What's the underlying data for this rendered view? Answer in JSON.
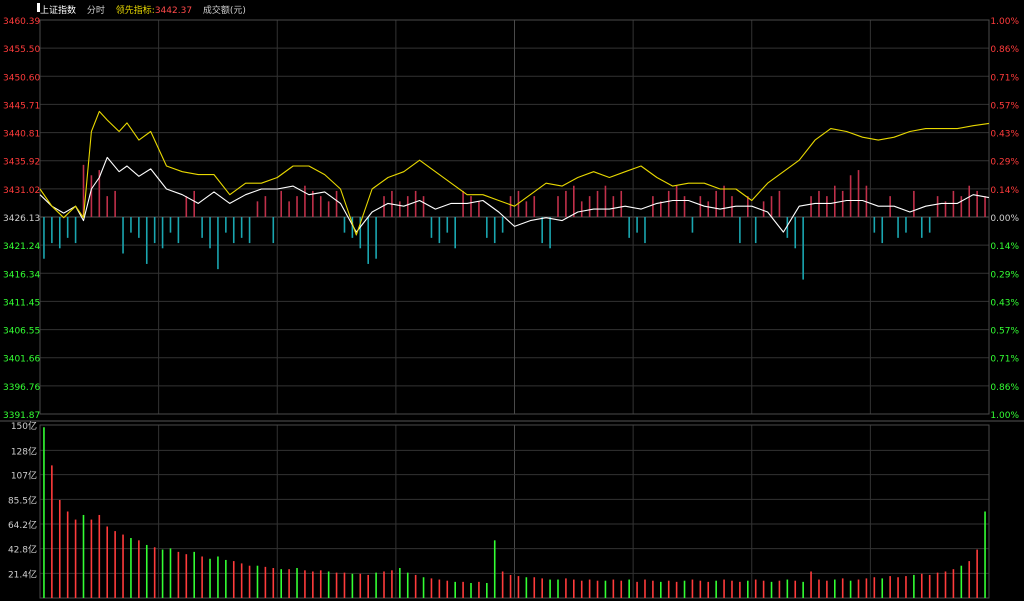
{
  "header": {
    "index_name": "上证指数",
    "tab_label": "分时",
    "leading_label": "领先指标:",
    "leading_value": "3442.37",
    "volume_label": "成交额(元)"
  },
  "colors": {
    "up": "#ff3b3b",
    "down": "#33ff33",
    "price_line": "#ffffff",
    "leading_line": "#e8d800",
    "bar_up": "#c0304a",
    "bar_down": "#1aa6b0",
    "grid": "#333333",
    "text": "#cfcfcf"
  },
  "chart_data": [
    {
      "type": "line",
      "price_axis": {
        "labels": [
          "3460.39",
          "3455.50",
          "3450.60",
          "3445.71",
          "3440.81",
          "3435.92",
          "3431.02",
          "3426.13",
          "3421.24",
          "3416.34",
          "3411.45",
          "3406.55",
          "3401.66",
          "3396.76",
          "3391.87"
        ],
        "ylim": [
          3391.87,
          3460.39
        ],
        "baseline": 3426.13
      },
      "percent_axis": {
        "labels": [
          "1.00%",
          "0.86%",
          "0.71%",
          "0.57%",
          "0.43%",
          "0.29%",
          "0.14%",
          "0.00%",
          "0.14%",
          "0.29%",
          "0.43%",
          "0.57%",
          "0.71%",
          "0.86%",
          "1.00%"
        ]
      },
      "x_range": [
        0,
        240
      ],
      "series": [
        {
          "key": "price",
          "x": [
            0,
            3,
            6,
            9,
            11,
            13,
            15,
            17,
            20,
            22,
            25,
            28,
            32,
            36,
            40,
            44,
            48,
            52,
            56,
            60,
            64,
            68,
            72,
            76,
            80,
            84,
            88,
            92,
            96,
            100,
            104,
            108,
            112,
            116,
            120,
            124,
            128,
            132,
            136,
            140,
            144,
            148,
            152,
            156,
            160,
            164,
            168,
            172,
            176,
            180,
            184,
            188,
            192,
            196,
            200,
            204,
            208,
            212,
            216,
            220,
            224,
            228,
            232,
            236,
            240
          ],
          "y": [
            3430,
            3428,
            3426.8,
            3428,
            3425.5,
            3431,
            3433,
            3436.5,
            3434,
            3435,
            3433.2,
            3434.5,
            3431,
            3430,
            3428.5,
            3430.5,
            3428.5,
            3430,
            3431,
            3431,
            3431.5,
            3430,
            3430.5,
            3428.5,
            3423.5,
            3427,
            3428.5,
            3428,
            3429,
            3427.5,
            3428.5,
            3428.5,
            3429,
            3427,
            3424.5,
            3425.5,
            3426,
            3425.5,
            3427,
            3427.5,
            3427.5,
            3428,
            3427.5,
            3428.5,
            3429,
            3429,
            3428,
            3427.5,
            3428,
            3428,
            3427,
            3423.5,
            3428,
            3428.5,
            3428.5,
            3429,
            3429,
            3428,
            3428,
            3427,
            3428,
            3428.5,
            3428.5,
            3430,
            3429.5
          ]
        },
        {
          "key": "leading",
          "x": [
            0,
            3,
            6,
            9,
            11,
            13,
            15,
            17,
            20,
            22,
            25,
            28,
            32,
            36,
            40,
            44,
            48,
            52,
            56,
            60,
            64,
            68,
            72,
            76,
            80,
            84,
            88,
            92,
            96,
            100,
            104,
            108,
            112,
            116,
            120,
            124,
            128,
            132,
            136,
            140,
            144,
            148,
            152,
            156,
            160,
            164,
            168,
            172,
            176,
            180,
            184,
            188,
            192,
            196,
            200,
            204,
            208,
            212,
            216,
            220,
            224,
            228,
            232,
            236,
            240
          ],
          "y": [
            3431,
            3428,
            3426,
            3428,
            3426,
            3441,
            3444.5,
            3443,
            3441,
            3442.5,
            3439.5,
            3441,
            3435,
            3434,
            3433.5,
            3433.5,
            3430,
            3432,
            3432,
            3433,
            3435,
            3435,
            3433.5,
            3431,
            3423,
            3431,
            3433,
            3434,
            3436,
            3434,
            3432,
            3430,
            3430,
            3429,
            3428,
            3430,
            3432,
            3431.5,
            3433,
            3434,
            3433,
            3434,
            3435,
            3433,
            3431.5,
            3432,
            3432,
            3431,
            3431,
            3429,
            3432,
            3434,
            3436,
            3439.5,
            3441.5,
            3441,
            3440,
            3439.5,
            3440,
            3441,
            3441.5,
            3441.5,
            3441.5,
            3442,
            3442.4
          ]
        }
      ],
      "flow_bars": {
        "x": [
          1,
          3,
          5,
          7,
          9,
          11,
          13,
          15,
          17,
          19,
          21,
          23,
          25,
          27,
          29,
          31,
          33,
          35,
          37,
          39,
          41,
          43,
          45,
          47,
          49,
          51,
          53,
          55,
          57,
          59,
          61,
          63,
          65,
          67,
          69,
          71,
          73,
          75,
          77,
          79,
          81,
          83,
          85,
          87,
          89,
          91,
          93,
          95,
          97,
          99,
          101,
          103,
          105,
          107,
          109,
          111,
          113,
          115,
          117,
          119,
          121,
          123,
          125,
          127,
          129,
          131,
          133,
          135,
          137,
          139,
          141,
          143,
          145,
          147,
          149,
          151,
          153,
          155,
          157,
          159,
          161,
          163,
          165,
          167,
          169,
          171,
          173,
          175,
          177,
          179,
          181,
          183,
          185,
          187,
          189,
          191,
          193,
          195,
          197,
          199,
          201,
          203,
          205,
          207,
          209,
          211,
          213,
          215,
          217,
          219,
          221,
          223,
          225,
          227,
          229,
          231,
          233,
          235,
          237,
          239
        ],
        "values": [
          -0.08,
          -0.05,
          -0.06,
          -0.04,
          -0.05,
          0.1,
          0.08,
          0.09,
          0.04,
          0.05,
          -0.07,
          -0.03,
          -0.04,
          -0.09,
          -0.05,
          -0.06,
          -0.03,
          -0.05,
          0.04,
          0.05,
          -0.04,
          -0.06,
          -0.1,
          -0.03,
          -0.05,
          -0.04,
          -0.05,
          0.03,
          0.04,
          -0.05,
          0.05,
          0.03,
          0.04,
          0.06,
          0.05,
          0.04,
          0.03,
          0.05,
          -0.03,
          -0.04,
          -0.06,
          -0.09,
          -0.08,
          0.04,
          0.05,
          0.03,
          0.04,
          0.05,
          0.04,
          -0.04,
          -0.05,
          -0.03,
          -0.06,
          0.05,
          0.04,
          0.03,
          -0.04,
          -0.05,
          -0.03,
          0.04,
          0.05,
          0.03,
          0.04,
          -0.05,
          -0.06,
          0.04,
          0.05,
          0.06,
          0.03,
          0.04,
          0.05,
          0.06,
          0.04,
          0.05,
          -0.04,
          -0.03,
          -0.05,
          0.04,
          0.03,
          0.05,
          0.06,
          0.04,
          -0.03,
          0.04,
          0.03,
          0.05,
          0.06,
          0.04,
          -0.05,
          0.04,
          -0.05,
          0.03,
          0.04,
          0.05,
          -0.04,
          -0.06,
          -0.12,
          0.04,
          0.05,
          0.04,
          0.06,
          0.05,
          0.08,
          0.09,
          0.06,
          -0.03,
          -0.05,
          0.04,
          -0.04,
          -0.03,
          0.05,
          -0.04,
          -0.03,
          0.04,
          0.03,
          0.05,
          0.04,
          0.06,
          0.05,
          0.04
        ]
      }
    },
    {
      "type": "bar",
      "y_axis": {
        "labels": [
          "150亿",
          "128亿",
          "107亿",
          "85.5亿",
          "64.2亿",
          "42.8亿",
          "21.4亿"
        ],
        "ylim": [
          0,
          150
        ]
      },
      "x_range": [
        0,
        240
      ],
      "bars": {
        "x": [
          1,
          3,
          5,
          7,
          9,
          11,
          13,
          15,
          17,
          19,
          21,
          23,
          25,
          27,
          29,
          31,
          33,
          35,
          37,
          39,
          41,
          43,
          45,
          47,
          49,
          51,
          53,
          55,
          57,
          59,
          61,
          63,
          65,
          67,
          69,
          71,
          73,
          75,
          77,
          79,
          81,
          83,
          85,
          87,
          89,
          91,
          93,
          95,
          97,
          99,
          101,
          103,
          105,
          107,
          109,
          111,
          113,
          115,
          117,
          119,
          121,
          123,
          125,
          127,
          129,
          131,
          133,
          135,
          137,
          139,
          141,
          143,
          145,
          147,
          149,
          151,
          153,
          155,
          157,
          159,
          161,
          163,
          165,
          167,
          169,
          171,
          173,
          175,
          177,
          179,
          181,
          183,
          185,
          187,
          189,
          191,
          193,
          195,
          197,
          199,
          201,
          203,
          205,
          207,
          209,
          211,
          213,
          215,
          217,
          219,
          221,
          223,
          225,
          227,
          229,
          231,
          233,
          235,
          237,
          239
        ],
        "values": [
          148,
          115,
          85,
          75,
          68,
          72,
          68,
          72,
          62,
          58,
          55,
          52,
          50,
          46,
          44,
          42,
          43,
          40,
          38,
          40,
          36,
          34,
          36,
          33,
          32,
          30,
          28,
          28,
          27,
          26,
          25,
          25,
          26,
          24,
          23,
          24,
          23,
          22,
          22,
          21,
          21,
          20,
          22,
          23,
          24,
          26,
          22,
          20,
          18,
          17,
          16,
          15,
          14,
          14,
          13,
          14,
          13,
          50,
          23,
          20,
          19,
          18,
          18,
          17,
          16,
          16,
          17,
          16,
          15,
          16,
          15,
          15,
          16,
          15,
          16,
          14,
          16,
          15,
          14,
          15,
          14,
          15,
          16,
          15,
          14,
          15,
          16,
          15,
          14,
          15,
          16,
          15,
          14,
          15,
          16,
          15,
          14,
          23,
          16,
          15,
          16,
          17,
          15,
          16,
          17,
          18,
          17,
          19,
          18,
          19,
          20,
          21,
          20,
          22,
          23,
          25,
          28,
          32,
          42,
          75
        ],
        "up": [
          0,
          1,
          1,
          1,
          1,
          0,
          1,
          1,
          1,
          1,
          1,
          0,
          1,
          0,
          1,
          0,
          0,
          1,
          1,
          0,
          1,
          0,
          0,
          0,
          1,
          1,
          1,
          0,
          1,
          1,
          0,
          1,
          0,
          1,
          1,
          1,
          0,
          1,
          1,
          0,
          1,
          1,
          0,
          1,
          1,
          0,
          0,
          1,
          0,
          1,
          1,
          1,
          0,
          1,
          0,
          1,
          0,
          0,
          1,
          1,
          1,
          0,
          1,
          1,
          0,
          0,
          1,
          1,
          1,
          1,
          1,
          0,
          1,
          1,
          0,
          1,
          1,
          1,
          0,
          1,
          1,
          0,
          1,
          1,
          1,
          0,
          1,
          1,
          1,
          0,
          1,
          1,
          0,
          1,
          0,
          1,
          0,
          1,
          1,
          1,
          0,
          1,
          0,
          1,
          1,
          1,
          0,
          1,
          1,
          1,
          0,
          1,
          1,
          1,
          1,
          1,
          0,
          1,
          1,
          0
        ]
      }
    }
  ]
}
